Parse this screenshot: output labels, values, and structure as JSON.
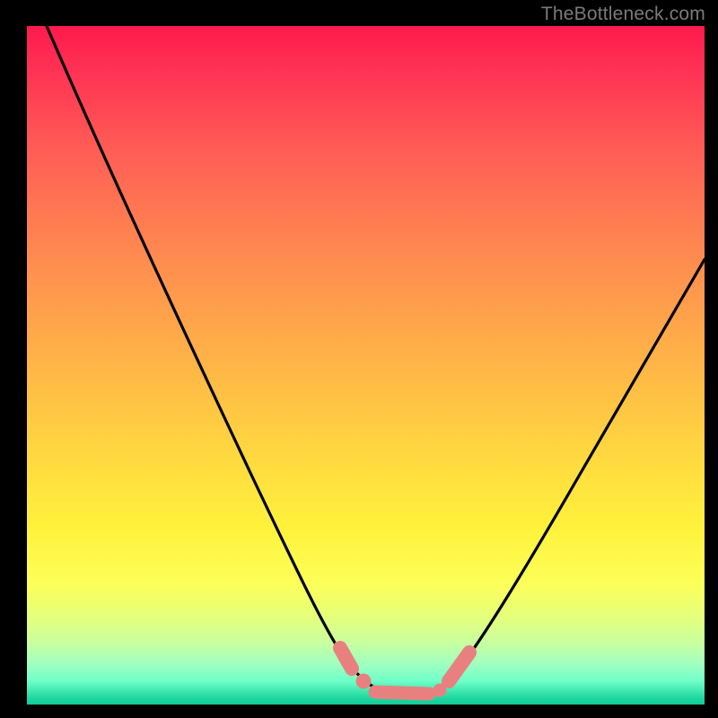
{
  "watermark": "TheBottleneck.com",
  "chart_data": {
    "type": "line",
    "title": "",
    "xlabel": "",
    "ylabel": "",
    "xlim": [
      0,
      100
    ],
    "ylim": [
      0,
      100
    ],
    "curve_approx": {
      "x": [
        3,
        10,
        20,
        30,
        40,
        47,
        50,
        53,
        56,
        60,
        63,
        70,
        80,
        90,
        100
      ],
      "y": [
        100,
        85,
        65,
        46,
        27,
        12,
        6,
        3,
        2,
        2,
        4,
        12,
        28,
        45,
        62
      ]
    },
    "markers_approx": {
      "x": [
        47.5,
        50,
        53.5,
        55,
        57.5,
        60,
        63,
        64.5
      ],
      "y": [
        11,
        6.5,
        3,
        2.2,
        2,
        2,
        4.5,
        7
      ]
    },
    "colors": {
      "curve": "#000000",
      "marker": "#e98080",
      "background_top": "#ff1a4d",
      "background_bottom": "#10cc98",
      "frame": "#000000"
    }
  }
}
